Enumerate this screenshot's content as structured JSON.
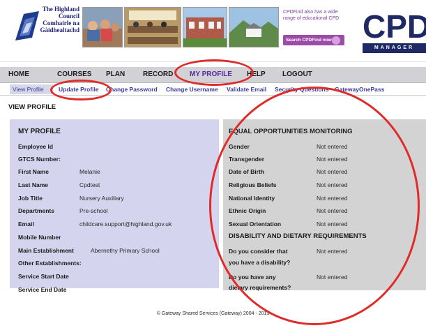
{
  "header": {
    "council_name_lines": [
      "The Highland",
      "Council",
      "Comhairle na",
      "Gàidhealtachd"
    ],
    "promo_lines": [
      "CPDFind also has a wide",
      "range of educational CPD"
    ],
    "promo_button": "Search CPDFind now",
    "cpd_logo_text": "CPD",
    "cpd_logo_sub": "MANAGER"
  },
  "main_nav": [
    "HOME",
    "COURSES",
    "PLAN",
    "RECORD",
    "MY PROFILE",
    "HELP",
    "LOGOUT"
  ],
  "sub_nav": [
    "View Profile",
    "Update Profile",
    "Change Password",
    "Change Username",
    "Validate Email",
    "Security Questions",
    "GatewayOnePass"
  ],
  "page_title": "VIEW PROFILE",
  "my_profile": {
    "heading": "MY PROFILE",
    "fields": [
      {
        "label": "Employee Id",
        "value": ""
      },
      {
        "label": "GTCS Number:",
        "value": ""
      },
      {
        "label": "First Name",
        "value": "Melanie"
      },
      {
        "label": "Last Name",
        "value": "Cpdtest"
      },
      {
        "label": "Job Title",
        "value": "Nursery Auxiliary"
      },
      {
        "label": "Departments",
        "value": "Pre-school"
      },
      {
        "label": "Email",
        "value": "childcare.support@highland.gov.uk"
      },
      {
        "label": "Mobile Number",
        "value": ""
      },
      {
        "label": "Main Establishment",
        "value": "Abernethy Primary School"
      },
      {
        "label": "Other Establishments:",
        "value": ""
      },
      {
        "label": "Service Start Date",
        "value": ""
      },
      {
        "label": "Service End Date",
        "value": ""
      }
    ]
  },
  "equal_opportunities": {
    "heading": "EQUAL OPPORTUNITIES MONITORING",
    "fields": [
      {
        "label": "Gender",
        "value": "Not entered"
      },
      {
        "label": "Transgender",
        "value": "Not entered"
      },
      {
        "label": "Date of Birth",
        "value": "Not entered"
      },
      {
        "label": "Religious Beliefs",
        "value": "Not entered"
      },
      {
        "label": "National Identity",
        "value": "Not entered"
      },
      {
        "label": "Ethnic Origin",
        "value": "Not entered"
      },
      {
        "label": "Sexual Orientation",
        "value": "Not entered"
      }
    ]
  },
  "disability": {
    "heading": "DISABILITY AND DIETARY REQUIREMENTS",
    "fields": [
      {
        "label_lines": [
          "Do you consider that",
          "you have a disability?"
        ],
        "value": "Not entered"
      },
      {
        "label_lines": [
          "Do you have any",
          "dietary requirements?"
        ],
        "value": "Not entered"
      }
    ]
  },
  "footer": "© Gateway Shared Services (Gateway) 2004 - 2013",
  "colors": {
    "left_panel_bg": "#d4d4ee",
    "right_panel_bg": "#d3d3d3",
    "nav_bg": "#d2d2d6",
    "annotation_red": "#e02b2b",
    "link_blue": "#3a3a9a"
  }
}
